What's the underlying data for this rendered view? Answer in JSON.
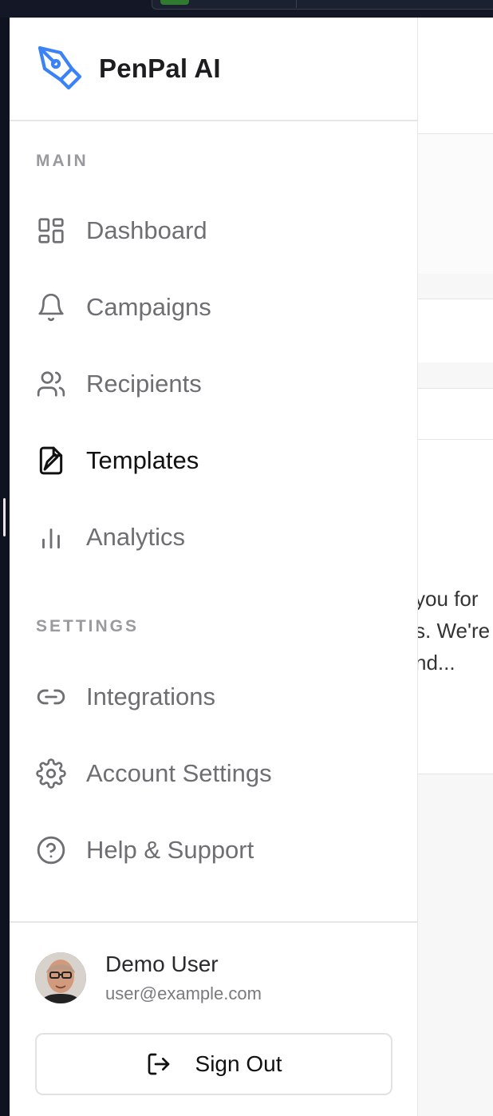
{
  "app": {
    "name": "PenPal AI",
    "brand_color": "#3b82f6"
  },
  "sidebar": {
    "sections": [
      {
        "label": "MAIN"
      },
      {
        "label": "SETTINGS"
      }
    ],
    "main_items": [
      {
        "label": "Dashboard",
        "icon": "dashboard-icon"
      },
      {
        "label": "Campaigns",
        "icon": "bell-icon"
      },
      {
        "label": "Recipients",
        "icon": "users-icon"
      },
      {
        "label": "Templates",
        "icon": "file-signature-icon",
        "active": true
      },
      {
        "label": "Analytics",
        "icon": "bar-chart-icon"
      }
    ],
    "settings_items": [
      {
        "label": "Integrations",
        "icon": "link-icon"
      },
      {
        "label": "Account Settings",
        "icon": "gear-icon"
      },
      {
        "label": "Help & Support",
        "icon": "help-circle-icon"
      }
    ]
  },
  "user": {
    "name": "Demo User",
    "email": "user@example.com"
  },
  "footer": {
    "signout_label": "Sign Out"
  },
  "background": {
    "text_lines": [
      "you for",
      "s. We're",
      "nd..."
    ]
  }
}
